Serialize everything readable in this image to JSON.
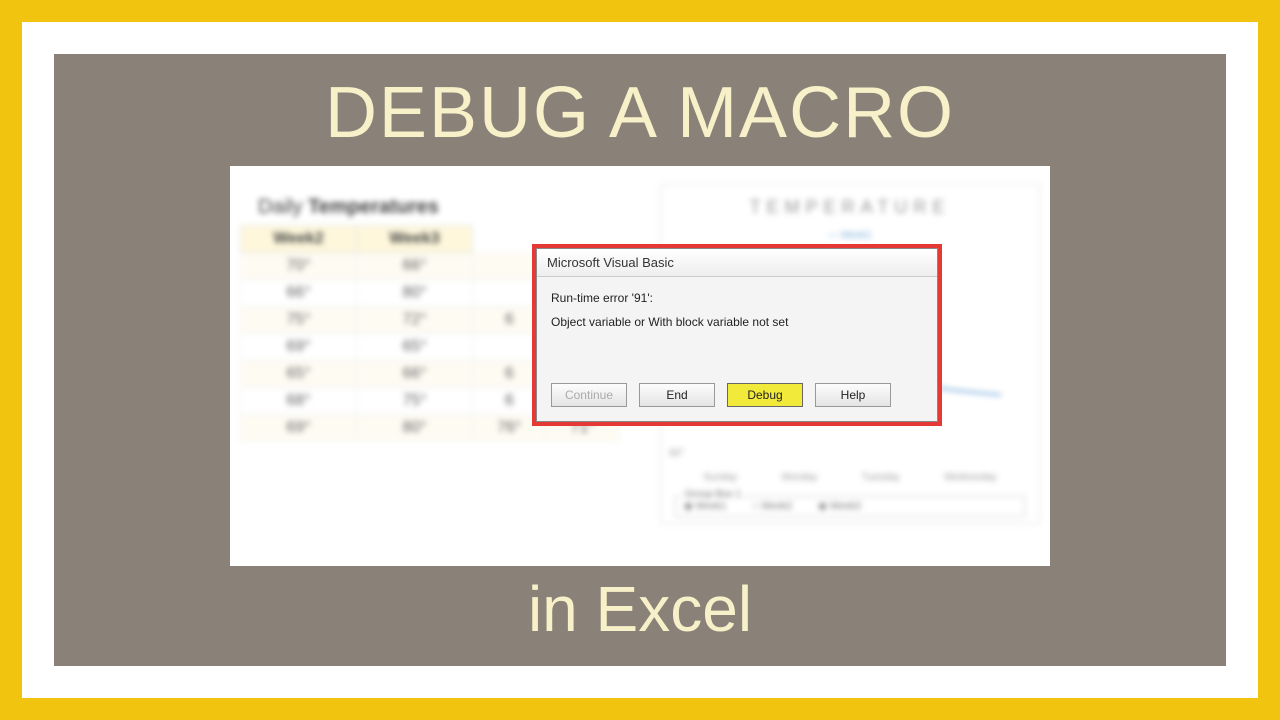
{
  "title": "DEBUG A MACRO",
  "subtitle": "in Excel",
  "sheet": {
    "heading_prefix": "Daily ",
    "heading_bold": "Temperatures",
    "headers": [
      "Week2",
      "Week3"
    ],
    "rows": [
      [
        "70°",
        "66°",
        ""
      ],
      [
        "66°",
        "80°",
        ""
      ],
      [
        "75°",
        "72°",
        "6"
      ],
      [
        "69°",
        "65°",
        ""
      ],
      [
        "65°",
        "66°",
        "6"
      ],
      [
        "68°",
        "75°",
        "6"
      ],
      [
        "69°",
        "80°",
        "76°",
        "71°"
      ]
    ]
  },
  "chart": {
    "title": "TEMPERATURE",
    "legend": "Week1",
    "xlabels": [
      "Sunday",
      "Monday",
      "Tuesday",
      "Wednesday"
    ],
    "ylabel": "60°",
    "group_title": "Group Box 1",
    "options": [
      "Week1",
      "Week2",
      "Week3"
    ]
  },
  "dialog": {
    "title": "Microsoft Visual Basic",
    "error_line": "Run-time error '91':",
    "error_msg": "Object variable or With block variable not set",
    "buttons": {
      "continue": "Continue",
      "end": "End",
      "debug": "Debug",
      "help": "Help"
    }
  }
}
